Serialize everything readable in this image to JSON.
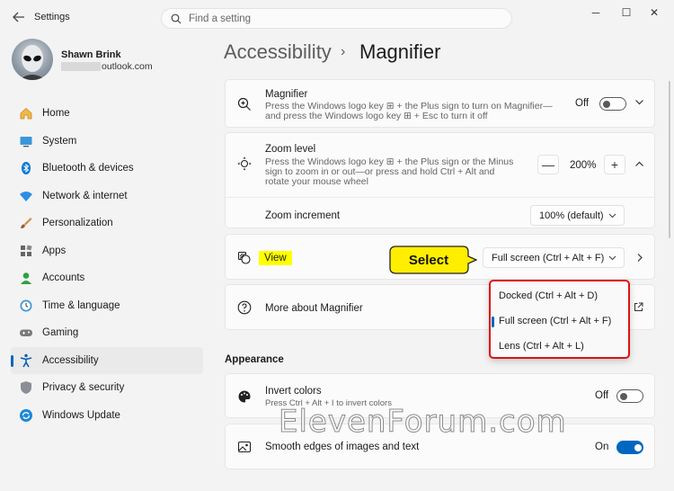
{
  "window": {
    "title": "Settings",
    "search_placeholder": "Find a setting",
    "minimize": "─",
    "maximize": "☐",
    "close": "✕"
  },
  "profile": {
    "name": "Shawn Brink",
    "email": "outlook.com"
  },
  "nav": [
    {
      "label": "Home",
      "icon": "home-icon"
    },
    {
      "label": "System",
      "icon": "system-icon"
    },
    {
      "label": "Bluetooth & devices",
      "icon": "bluetooth-icon"
    },
    {
      "label": "Network & internet",
      "icon": "network-icon"
    },
    {
      "label": "Personalization",
      "icon": "brush-icon"
    },
    {
      "label": "Apps",
      "icon": "apps-icon"
    },
    {
      "label": "Accounts",
      "icon": "accounts-icon"
    },
    {
      "label": "Time & language",
      "icon": "clock-icon"
    },
    {
      "label": "Gaming",
      "icon": "gaming-icon"
    },
    {
      "label": "Accessibility",
      "icon": "accessibility-icon",
      "active": true
    },
    {
      "label": "Privacy & security",
      "icon": "shield-icon"
    },
    {
      "label": "Windows Update",
      "icon": "update-icon"
    }
  ],
  "header": {
    "parent": "Accessibility",
    "sep": "›",
    "current": "Magnifier"
  },
  "magnifier": {
    "title": "Magnifier",
    "desc1": "Press the Windows logo key ⊞ + the Plus sign to turn on Magnifier—",
    "desc2": "and press the Windows logo key ⊞ + Esc to turn it off",
    "state": "Off"
  },
  "zoom": {
    "title": "Zoom level",
    "desc1": "Press the Windows logo key ⊞ + the Plus sign or the Minus",
    "desc2": "sign to zoom in or out—or press and hold Ctrl + Alt and",
    "desc3": "rotate your mouse wheel",
    "value": "200%",
    "minus": "—",
    "plus": "+"
  },
  "zoom_increment": {
    "label": "Zoom increment",
    "value": "100% (default)"
  },
  "view": {
    "label": "View",
    "value": "Full screen (Ctrl + Alt + F)",
    "callout": "Select"
  },
  "view_options": [
    "Docked (Ctrl + Alt + D)",
    "Full screen (Ctrl + Alt + F)",
    "Lens (Ctrl + Alt + L)"
  ],
  "more": {
    "label": "More about Magnifier"
  },
  "appearance": {
    "section": "Appearance",
    "invert_title": "Invert colors",
    "invert_desc": "Press Ctrl + Alt + I to invert colors",
    "invert_state": "Off",
    "smooth_title": "Smooth edges of images and text",
    "smooth_state": "On"
  },
  "watermark": "ElevenForum.com",
  "colors": {
    "accent": "#0067c0",
    "highlight": "#ffff00",
    "callout": "#ffee00",
    "flyout_border": "#dd1111"
  }
}
